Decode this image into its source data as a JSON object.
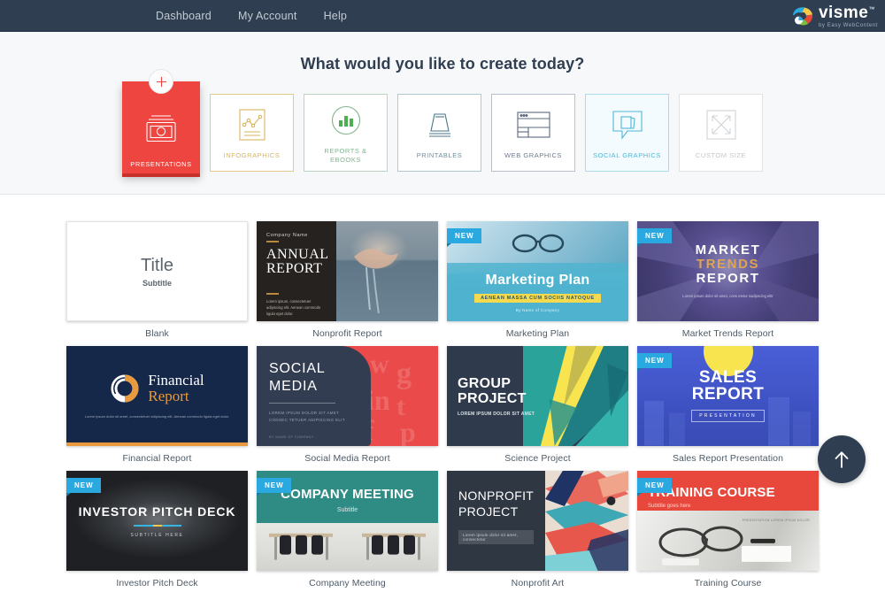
{
  "topbar": {
    "nav": [
      {
        "label": "Dashboard",
        "name": "nav-dashboard"
      },
      {
        "label": "My Account",
        "name": "nav-my-account"
      },
      {
        "label": "Help",
        "name": "nav-help"
      }
    ],
    "brand": {
      "name": "visme",
      "tm": "™",
      "tagline": "by Easy WebContent"
    },
    "bg_color": "#2f3e50"
  },
  "hero": {
    "title": "What would you like to create today?",
    "categories": [
      {
        "label": "PRESENTATIONS",
        "icon": "presentation-icon",
        "active": true,
        "badge": "plus-icon",
        "color": "#ee4540"
      },
      {
        "label": "INFOGRAPHICS",
        "icon": "infographic-icon",
        "active": false,
        "color": "#d9b45f"
      },
      {
        "label": "REPORTS & EBOOKS",
        "icon": "reports-ebooks-icon",
        "active": false,
        "color": "#7fb58e"
      },
      {
        "label": "PRINTABLES",
        "icon": "printables-icon",
        "active": false,
        "color": "#6e8f9c"
      },
      {
        "label": "WEB GRAPHICS",
        "icon": "web-graphics-icon",
        "active": false,
        "color": "#6d7a8c"
      },
      {
        "label": "SOCIAL GRAPHICS",
        "icon": "social-graphics-icon",
        "active": false,
        "color": "#4fb6d8"
      },
      {
        "label": "CUSTOM SIZE",
        "icon": "custom-size-icon",
        "active": false,
        "color": "#c2c6c9"
      }
    ]
  },
  "templates": [
    {
      "name": "Blank",
      "new": false,
      "slide": {
        "title": "Title",
        "subtitle": "Subtitle"
      }
    },
    {
      "name": "Nonprofit Report",
      "new": false,
      "slide": {
        "company": "Company Name",
        "title_line1": "ANNUAL",
        "title_line2": "REPORT",
        "body": "Lorem ipsum, consectetuer adipiscing elit. Aenean commodo ligula eget dolor."
      }
    },
    {
      "name": "Marketing Plan",
      "new": true,
      "slide": {
        "title": "Marketing Plan",
        "highlight": "AENEAN MASSA CUM SOCIIS NATOQUE",
        "byline": "By Name of Company"
      }
    },
    {
      "name": "Market Trends Report",
      "new": true,
      "slide": {
        "line1": "MARKET",
        "line2": "TRENDS",
        "line3": "REPORT",
        "body": "Lorem ipsum dolor sit amet, cons etetur sadipscing elitr"
      }
    },
    {
      "name": "Financial Report",
      "new": false,
      "slide": {
        "title1": "Financial",
        "title2": "Report",
        "body": "Lorem ipsum dolor sit amet, consectetuer adipiscing elit. Aenean commodo ligula eget dolor."
      }
    },
    {
      "name": "Social Media Report",
      "new": false,
      "slide": {
        "line1": "SOCIAL",
        "line2": "MEDIA",
        "body": "LOREM IPSUM DOLOR SIT AMET CONSEC TETUER ADIPISCING ELIT",
        "footer": "BY NAME OF COMPANY"
      }
    },
    {
      "name": "Science Project",
      "new": false,
      "slide": {
        "line1": "GROUP",
        "line2": "PROJECT",
        "subtitle": "LOREM IPSUM DOLOR SIT AMET"
      }
    },
    {
      "name": "Sales Report Presentation",
      "new": true,
      "slide": {
        "line1": "SALES",
        "line2": "REPORT",
        "badge": "PRESENTATION"
      }
    },
    {
      "name": "Investor Pitch Deck",
      "new": true,
      "slide": {
        "title": "INVESTOR PITCH DECK",
        "subtitle": "SUBTITLE HERE"
      }
    },
    {
      "name": "Company Meeting",
      "new": true,
      "slide": {
        "title": "COMPANY MEETING",
        "subtitle": "Subtitle"
      }
    },
    {
      "name": "Nonprofit Art",
      "new": true,
      "slide": {
        "line1": "NONPROFIT",
        "line2": "PROJECT",
        "caption": "Lorem ipsum dolor sit amet, consectetur"
      }
    },
    {
      "name": "Training Course",
      "new": true,
      "slide": {
        "title": "TRAINING COURSE",
        "subtitle": "Subtitle goes here",
        "corner": "PRESENTATION LOREM IPSUM DOLOR"
      }
    }
  ],
  "new_badge_label": "NEW",
  "scroll_top": {
    "name": "scroll-to-top-button",
    "icon": "arrow-up-icon"
  }
}
